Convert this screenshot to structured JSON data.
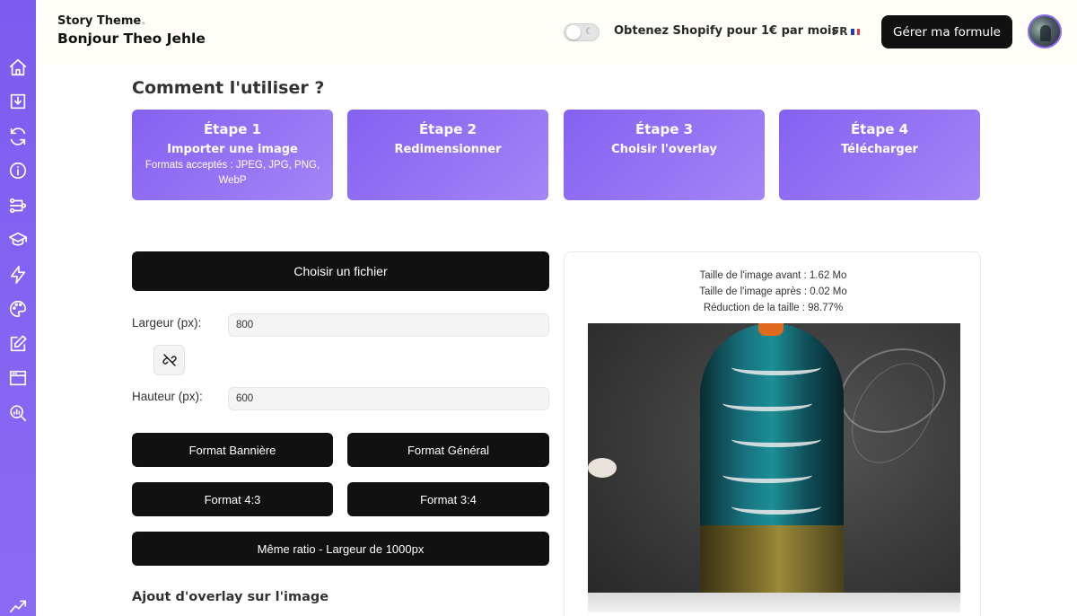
{
  "header": {
    "brand": "Story Theme",
    "brand_dot": ".",
    "greeting": "Bonjour Theo Jehle",
    "promo": "Obtenez Shopify pour 1€ par mois",
    "lang": "FR",
    "manage_button": "Gérer ma formule",
    "dark_mode_icon": "☾"
  },
  "sidebar": {
    "items": [
      "home-icon",
      "download-icon",
      "refresh-icon",
      "info-icon",
      "flow-icon",
      "graduation-cap-icon",
      "lightning-icon",
      "palette-icon",
      "edit-icon",
      "browser-window-icon",
      "search-chart-icon",
      "trending-up-icon"
    ]
  },
  "main": {
    "section_title": "Comment l'utiliser ?",
    "steps": [
      {
        "title": "Étape 1",
        "subtitle": "Importer une image",
        "desc": "Formats acceptés : JPEG, JPG, PNG, WebP"
      },
      {
        "title": "Étape 2",
        "subtitle": "Redimensionner",
        "desc": ""
      },
      {
        "title": "Étape 3",
        "subtitle": "Choisir l'overlay",
        "desc": ""
      },
      {
        "title": "Étape 4",
        "subtitle": "Télécharger",
        "desc": ""
      }
    ],
    "choose_file": "Choisir un fichier",
    "width_label": "Largeur (px):",
    "width_value": "800",
    "height_label": "Hauteur (px):",
    "height_value": "600",
    "format_buttons": [
      "Format Bannière",
      "Format Général",
      "Format 4:3",
      "Format 3:4",
      "Même ratio - Largeur de 1000px"
    ],
    "overlay_title": "Ajout d'overlay sur l'image"
  },
  "preview": {
    "size_before": "Taille de l'image avant : 1.62 Mo",
    "size_after": "Taille de l'image après : 0.02 Mo",
    "reduction": "Réduction de la taille : 98.77%"
  },
  "colors": {
    "accent": "#8561f2",
    "button": "#111111"
  }
}
